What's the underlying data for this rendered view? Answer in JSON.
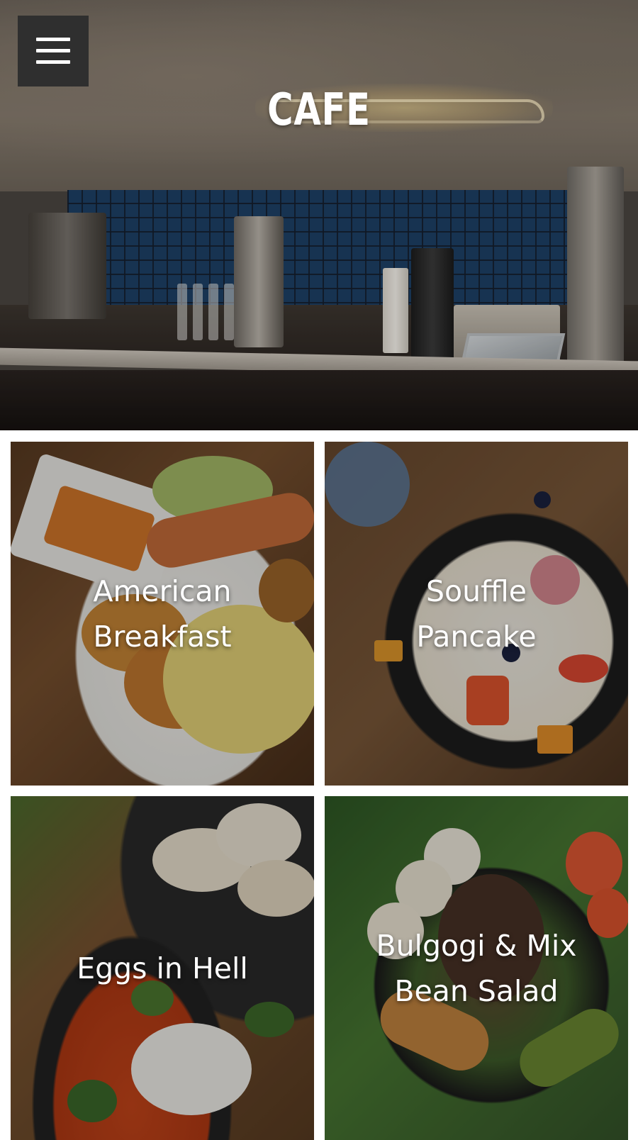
{
  "app": {
    "brand_title": "CAFE"
  },
  "header": {
    "menu_icon": "hamburger-menu-icon"
  },
  "menu_items": [
    {
      "line1": "American",
      "line2": "Breakfast"
    },
    {
      "line1": "Souffle",
      "line2": "Pancake"
    },
    {
      "line1": "Eggs in Hell",
      "line2": ""
    },
    {
      "line1": "Bulgogi & Mix",
      "line2": "Bean Salad"
    }
  ],
  "colors": {
    "menu_button_bg": "#2f2f2f",
    "text": "#ffffff",
    "page_bg": "#ffffff"
  }
}
